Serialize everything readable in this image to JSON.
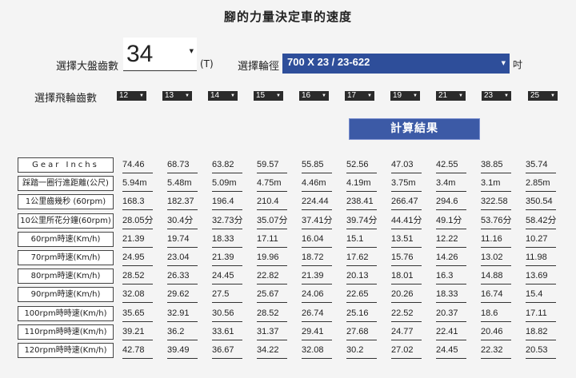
{
  "title": "腳的力量決定車的速度",
  "chainring": {
    "label": "選擇大盤齒數",
    "value": "34",
    "unit": "(T)"
  },
  "wheel": {
    "label": "選擇輪徑",
    "value": "700 X 23 / 23-622",
    "unit": "吋"
  },
  "cogs": {
    "label": "選擇飛輪齒數",
    "values": [
      "12",
      "13",
      "14",
      "15",
      "16",
      "17",
      "19",
      "21",
      "23",
      "25"
    ]
  },
  "calculate_label": "計算結果",
  "table": {
    "rows": [
      {
        "label": "Gear Inchs",
        "values": [
          "74.46",
          "68.73",
          "63.82",
          "59.57",
          "55.85",
          "52.56",
          "47.03",
          "42.55",
          "38.85",
          "35.74"
        ]
      },
      {
        "label": "踩踏一圈行進距離(公尺)",
        "values": [
          "5.94m",
          "5.48m",
          "5.09m",
          "4.75m",
          "4.46m",
          "4.19m",
          "3.75m",
          "3.4m",
          "3.1m",
          "2.85m"
        ]
      },
      {
        "label": "1公里齒幾秒 (60rpm)",
        "values": [
          "168.3",
          "182.37",
          "196.4",
          "210.4",
          "224.44",
          "238.41",
          "266.47",
          "294.6",
          "322.58",
          "350.54"
        ]
      },
      {
        "label": "10公里所花分鐘(60rpm)",
        "values": [
          "28.05分",
          "30.4分",
          "32.73分",
          "35.07分",
          "37.41分",
          "39.74分",
          "44.41分",
          "49.1分",
          "53.76分",
          "58.42分"
        ]
      },
      {
        "label": "60rpm時速(Km/h)",
        "values": [
          "21.39",
          "19.74",
          "18.33",
          "17.11",
          "16.04",
          "15.1",
          "13.51",
          "12.22",
          "11.16",
          "10.27"
        ]
      },
      {
        "label": "70rpm時速(Km/h)",
        "values": [
          "24.95",
          "23.04",
          "21.39",
          "19.96",
          "18.72",
          "17.62",
          "15.76",
          "14.26",
          "13.02",
          "11.98"
        ]
      },
      {
        "label": "80rpm時速(Km/h)",
        "values": [
          "28.52",
          "26.33",
          "24.45",
          "22.82",
          "21.39",
          "20.13",
          "18.01",
          "16.3",
          "14.88",
          "13.69"
        ]
      },
      {
        "label": "90rpm時速(Km/h)",
        "values": [
          "32.08",
          "29.62",
          "27.5",
          "25.67",
          "24.06",
          "22.65",
          "20.26",
          "18.33",
          "16.74",
          "15.4"
        ]
      },
      {
        "label": "100rpm時時速(Km/h)",
        "values": [
          "35.65",
          "32.91",
          "30.56",
          "28.52",
          "26.74",
          "25.16",
          "22.52",
          "20.37",
          "18.6",
          "17.11"
        ]
      },
      {
        "label": "110rpm時時速(Km/h)",
        "values": [
          "39.21",
          "36.2",
          "33.61",
          "31.37",
          "29.41",
          "27.68",
          "24.77",
          "22.41",
          "20.46",
          "18.82"
        ]
      },
      {
        "label": "120rpm時時速(Km/h)",
        "values": [
          "42.78",
          "39.49",
          "36.67",
          "34.22",
          "32.08",
          "30.2",
          "27.02",
          "24.45",
          "22.32",
          "20.53"
        ]
      }
    ]
  },
  "colors": {
    "accent": "#2e4e9a",
    "button": "#3c5aa6",
    "cog_bg": "#2b2b2b"
  },
  "icons": {
    "select_arrow": "triangle-down-icon"
  }
}
